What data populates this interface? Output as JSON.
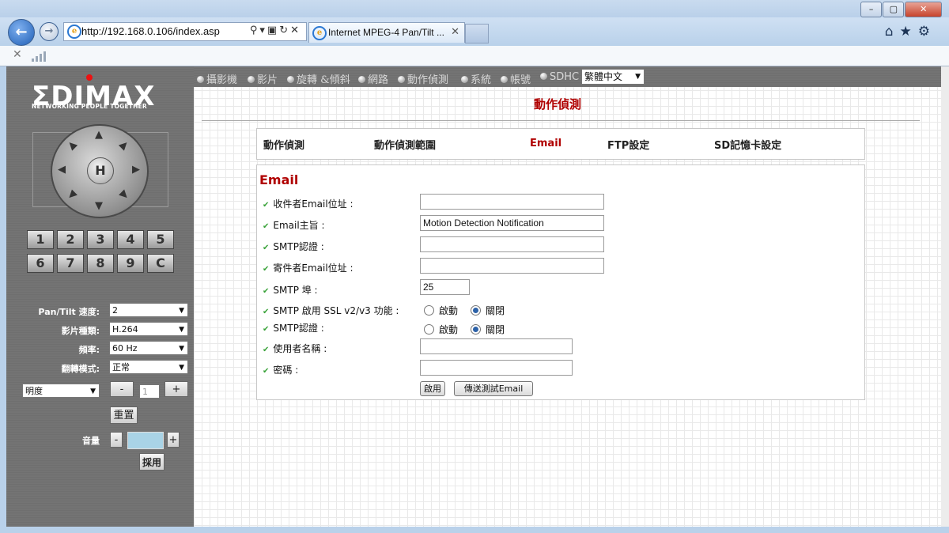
{
  "browser": {
    "address": "http://192.168.0.106/index.asp",
    "tab_title": "Internet MPEG-4 Pan/Tilt ...",
    "window_buttons": [
      "–",
      "▢",
      "✕"
    ],
    "toolbar_icons": [
      "home-icon",
      "star-icon",
      "gear-icon"
    ]
  },
  "sidebar": {
    "logo": "ΣDIMAX",
    "slogan": "NETWORKING PEOPLE TOGETHER",
    "ptz_center": "H",
    "keys_row1": [
      "1",
      "2",
      "3",
      "4",
      "5"
    ],
    "keys_row2": [
      "6",
      "7",
      "8",
      "9",
      "C"
    ],
    "pantilt_label": "Pan/Tilt 速度:",
    "pantilt_value": "2",
    "video_type_label": "影片種類:",
    "video_type_value": "H.264",
    "frequency_label": "頻率:",
    "frequency_value": "60 Hz",
    "flip_label": "翻轉模式:",
    "flip_value": "正常",
    "brightness_select": "明度",
    "minus": "-",
    "brightness_value": "1",
    "plus": "+",
    "reset": "重置",
    "volume_label": "音量",
    "volume_minus": "-",
    "volume_plus": "+",
    "apply": "採用"
  },
  "topmenu": {
    "items": [
      "攝影機",
      "影片",
      "旋轉 &傾斜",
      "網路",
      "動作偵測",
      "系統",
      "帳號",
      "SDHC"
    ],
    "language": "繁體中文"
  },
  "main": {
    "page_title": "動作偵測",
    "subtabs": [
      "動作偵測",
      "動作偵測範圍",
      "Email",
      "FTP設定",
      "SD記憶卡設定"
    ],
    "form_title": "Email",
    "fields": {
      "recipient_label": "收件者Email位址 :",
      "recipient_value": "",
      "subject_label": "Email主旨 :",
      "subject_value": "Motion Detection Notification",
      "smtp_auth_label": "SMTP認證 :",
      "smtp_auth_value": "",
      "sender_label": "寄件者Email位址 :",
      "sender_value": "",
      "smtp_port_label": "SMTP 埠 :",
      "smtp_port_value": "25",
      "ssl_label": "SMTP 啟用 SSL v2/v3 功能 :",
      "ssl_on": "啟動",
      "ssl_off": "關閉",
      "smtp_auth2_label": "SMTP認證 :",
      "auth_on": "啟動",
      "auth_off": "關閉",
      "username_label": "使用者名稱 :",
      "username_value": "",
      "password_label": "密碼 :",
      "password_value": ""
    },
    "apply_button": "啟用",
    "test_button": "傳送測試Email"
  }
}
